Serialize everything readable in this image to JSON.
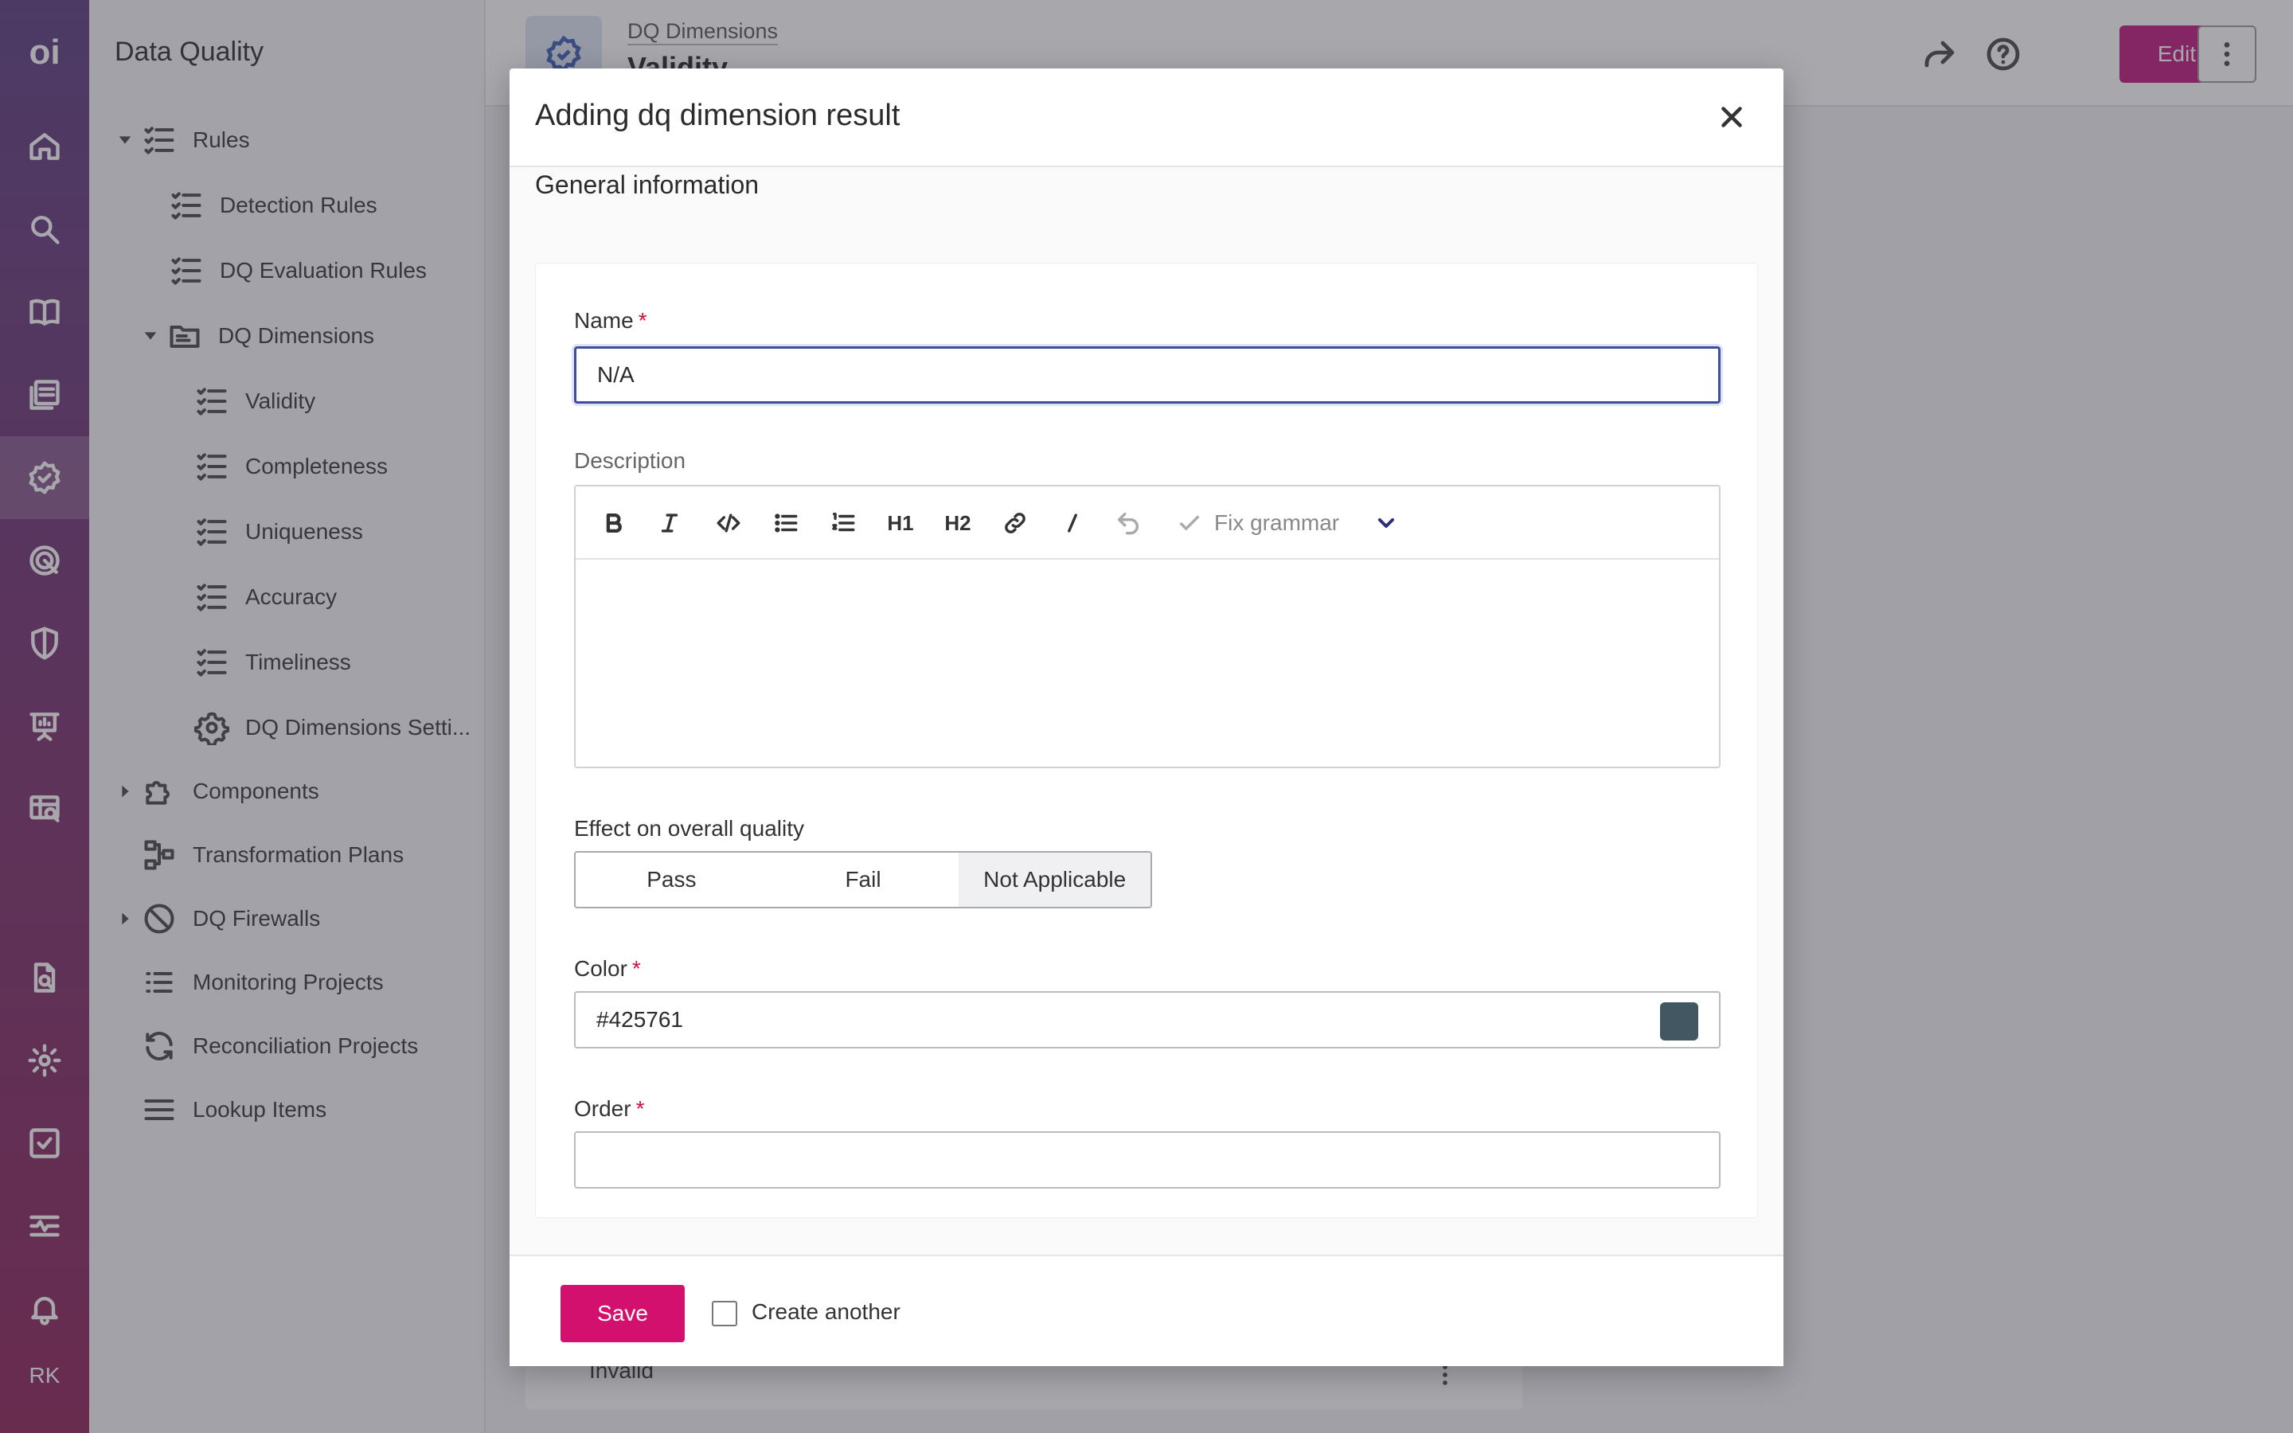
{
  "rail": {
    "logo": "oi",
    "user_initials": "RK"
  },
  "sidebar": {
    "title": "Data Quality",
    "items": [
      {
        "label": "Rules"
      },
      {
        "label": "Detection Rules"
      },
      {
        "label": "DQ Evaluation Rules"
      },
      {
        "label": "DQ Dimensions"
      },
      {
        "label": "Validity"
      },
      {
        "label": "Completeness"
      },
      {
        "label": "Uniqueness"
      },
      {
        "label": "Accuracy"
      },
      {
        "label": "Timeliness"
      },
      {
        "label": "DQ Dimensions Setti..."
      },
      {
        "label": "Components"
      },
      {
        "label": "Transformation Plans"
      },
      {
        "label": "DQ Firewalls"
      },
      {
        "label": "Monitoring Projects"
      },
      {
        "label": "Reconciliation Projects"
      },
      {
        "label": "Lookup Items"
      }
    ]
  },
  "header": {
    "breadcrumb": "DQ Dimensions",
    "title": "Validity",
    "edit_label": "Edit"
  },
  "background_row": {
    "label": "Invalid"
  },
  "modal": {
    "title": "Adding dq dimension result",
    "section_title": "General information",
    "name": {
      "label": "Name",
      "required_mark": "*",
      "value": "N/A"
    },
    "description": {
      "label": "Description",
      "toolbar": {
        "h1": "H1",
        "h2": "H2",
        "fix_grammar": "Fix grammar"
      }
    },
    "effect": {
      "label": "Effect on overall quality",
      "options": [
        "Pass",
        "Fail",
        "Not Applicable"
      ],
      "selected": "Not Applicable"
    },
    "color": {
      "label": "Color",
      "required_mark": "*",
      "value": "#425761",
      "swatch": "#425761"
    },
    "order": {
      "label": "Order",
      "required_mark": "*",
      "value": ""
    },
    "footer": {
      "save_label": "Save",
      "create_another_label": "Create another"
    }
  },
  "colors": {
    "accent": "#d4106e",
    "edit_button": "#c0147a"
  }
}
